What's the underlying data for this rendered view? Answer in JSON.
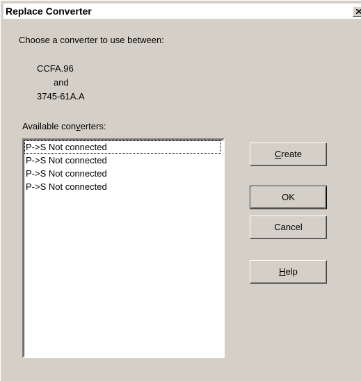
{
  "window": {
    "title": "Replace Converter",
    "close_glyph": "×"
  },
  "prompt": {
    "text": "Choose a converter to use between:",
    "first_item": "CCFA.96",
    "conjunction": "and",
    "second_item": "3745-61A.A"
  },
  "converters": {
    "label_before": "Available con",
    "label_mnemonic": "v",
    "label_after": "erters:",
    "items": [
      "P->S Not connected",
      "P->S Not connected",
      "P->S Not connected",
      "P->S Not connected"
    ],
    "focused_index": 0
  },
  "buttons": {
    "create": {
      "mnemonic": "C",
      "rest": "reate"
    },
    "ok": {
      "label": "OK"
    },
    "cancel": {
      "label": "Cancel"
    },
    "help": {
      "mnemonic": "H",
      "rest": "elp"
    }
  },
  "colors": {
    "dialog_bg": "#d4d0c8",
    "title_bg": "#ffffff",
    "list_bg": "#ffffff"
  },
  "icons": {
    "close": "close-icon"
  }
}
